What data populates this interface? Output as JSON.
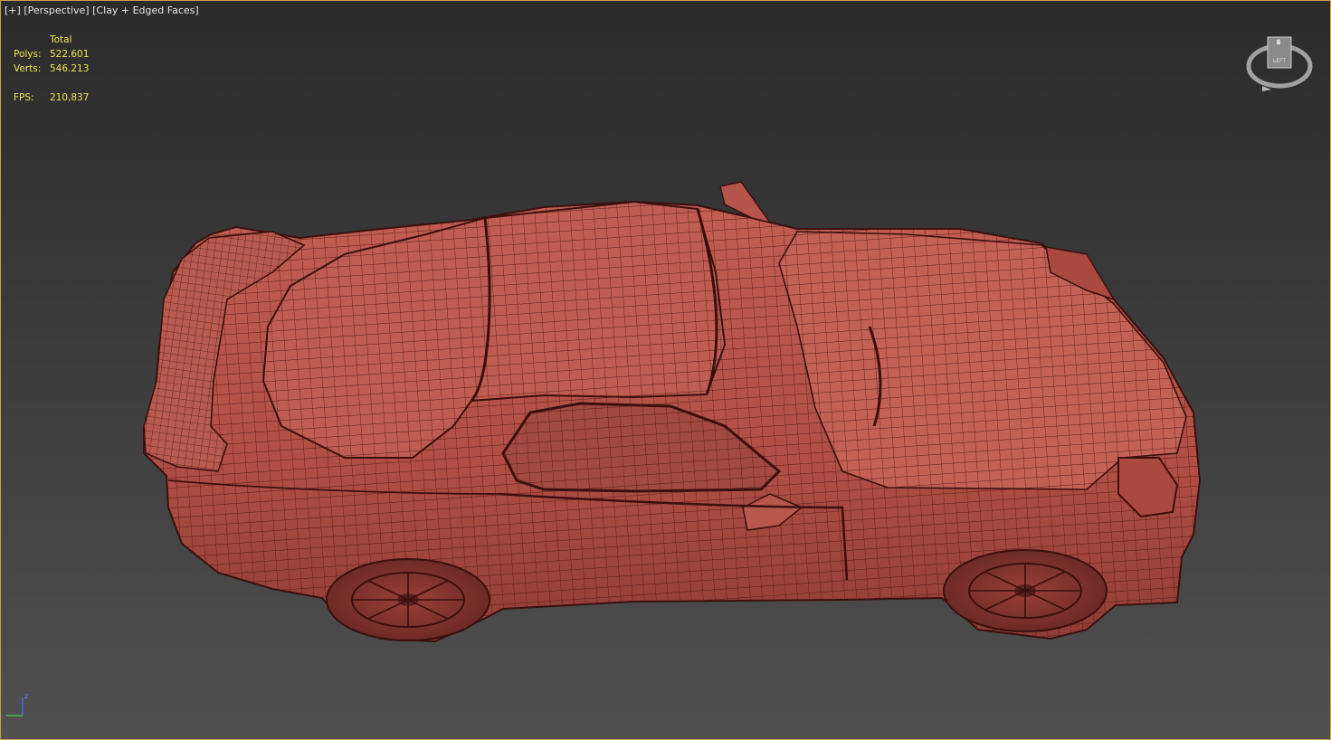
{
  "viewport": {
    "label_plus": "[+]",
    "label_view": "[Perspective]",
    "label_shading": "[Clay + Edged Faces]"
  },
  "stats": {
    "header": "Total",
    "polys_label": "Polys:",
    "polys_value": "522.601",
    "verts_label": "Verts:",
    "verts_value": "546.213",
    "fps_label": "FPS:",
    "fps_value": "210,837"
  },
  "viewcube": {
    "face_label": "LEFT"
  },
  "axis": {
    "z_label": "z"
  },
  "colors": {
    "frame_border": "#c8a24a",
    "stats_text": "#f1e64a",
    "model_fill": "#b5534a",
    "wire": "#4a1410"
  }
}
